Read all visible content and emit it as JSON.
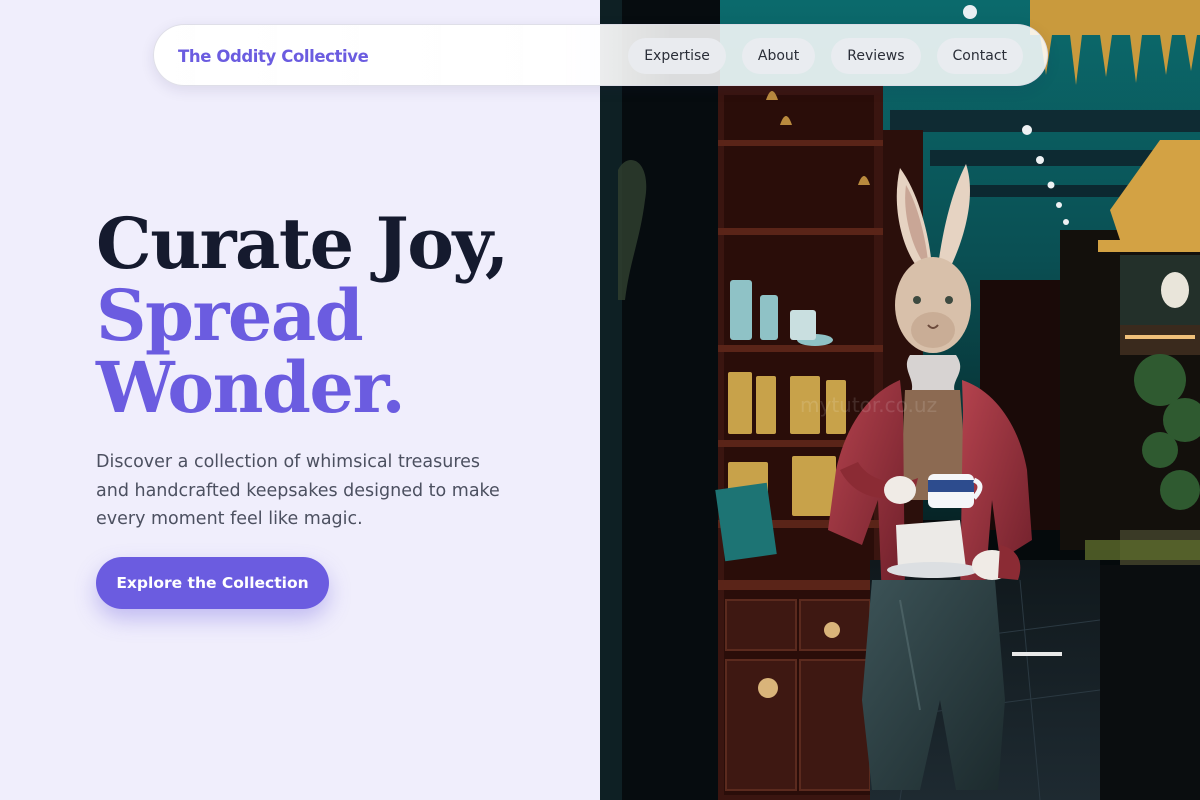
{
  "brand": {
    "name": "The Oddity Collective"
  },
  "nav": {
    "items": [
      {
        "label": "Expertise"
      },
      {
        "label": "About"
      },
      {
        "label": "Reviews"
      },
      {
        "label": "Contact"
      }
    ]
  },
  "hero": {
    "heading_line1": "Curate Joy,",
    "heading_line2": "Spread",
    "heading_line3": "Wonder.",
    "description": "Discover a collection of whimsical treasures and handcrafted keepsakes designed to make every moment feel like magic.",
    "cta_label": "Explore the Collection"
  },
  "colors": {
    "accent": "#6b5ce0",
    "heading_dark": "#151a2e",
    "background": "#f0eefc"
  }
}
